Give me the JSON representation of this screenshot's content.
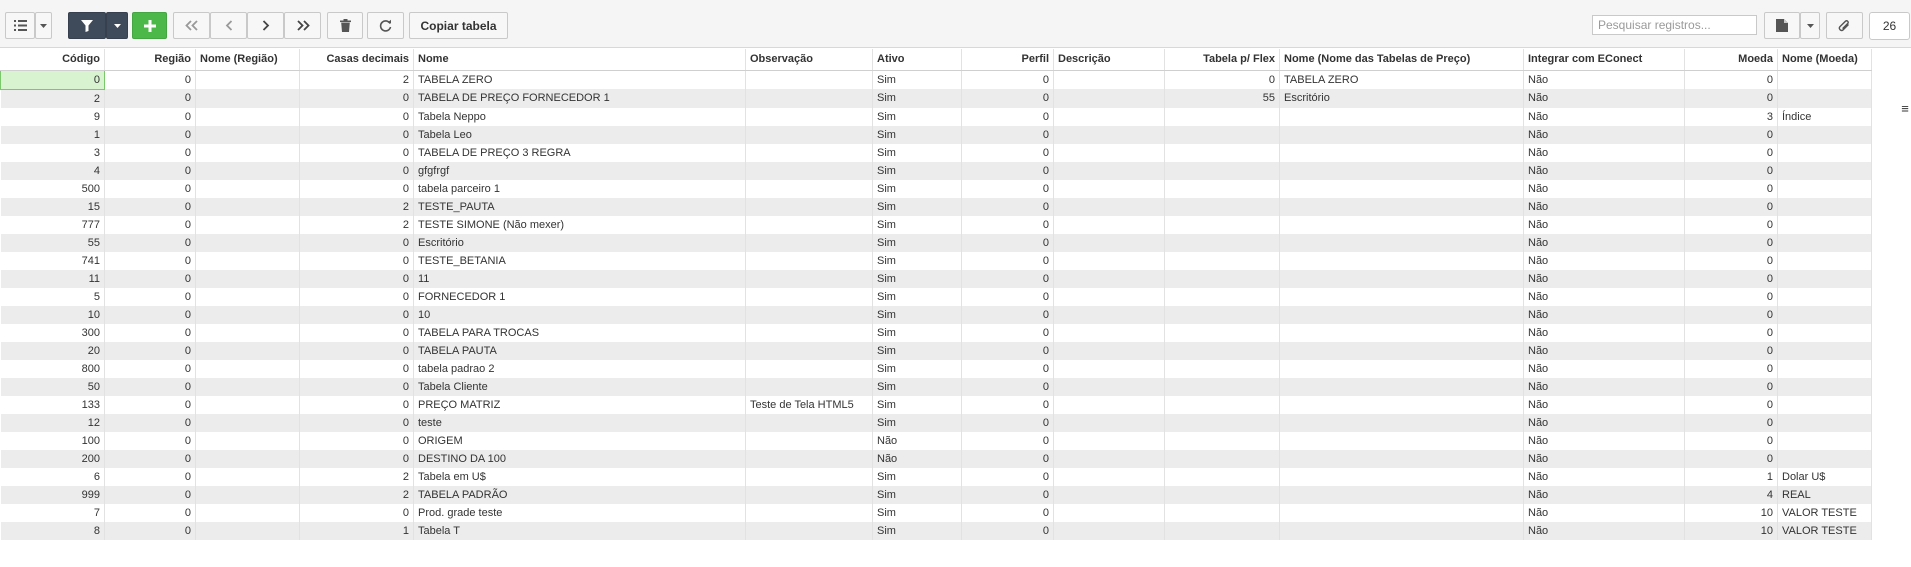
{
  "toolbar": {
    "copy_label": "Copiar tabela",
    "search_placeholder": "Pesquisar registros...",
    "page_size": "26"
  },
  "columns": [
    {
      "key": "codigo",
      "label": "Código",
      "align": "r"
    },
    {
      "key": "regiao",
      "label": "Região",
      "align": "r"
    },
    {
      "key": "nome_regiao",
      "label": "Nome (Região)",
      "align": "l"
    },
    {
      "key": "casas",
      "label": "Casas decimais",
      "align": "r"
    },
    {
      "key": "nome",
      "label": "Nome",
      "align": "l"
    },
    {
      "key": "obs",
      "label": "Observação",
      "align": "l"
    },
    {
      "key": "ativo",
      "label": "Ativo",
      "align": "l"
    },
    {
      "key": "perfil",
      "label": "Perfil",
      "align": "r"
    },
    {
      "key": "descricao",
      "label": "Descrição",
      "align": "l"
    },
    {
      "key": "flex",
      "label": "Tabela p/ Flex",
      "align": "r"
    },
    {
      "key": "nome_tab",
      "label": "Nome (Nome das Tabelas de Preço)",
      "align": "l"
    },
    {
      "key": "econect",
      "label": "Integrar com EConect",
      "align": "l"
    },
    {
      "key": "moeda",
      "label": "Moeda",
      "align": "r"
    },
    {
      "key": "nome_moeda",
      "label": "Nome (Moeda)",
      "align": "l"
    }
  ],
  "rows": [
    [
      "0",
      "0",
      "",
      "2",
      "TABELA ZERO",
      "",
      "Sim",
      "0",
      "",
      "0",
      "TABELA ZERO",
      "Não",
      "0",
      ""
    ],
    [
      "2",
      "0",
      "",
      "0",
      "TABELA DE PREÇO FORNECEDOR 1",
      "",
      "Sim",
      "0",
      "",
      "55",
      "Escritório",
      "Não",
      "0",
      ""
    ],
    [
      "9",
      "0",
      "",
      "0",
      "Tabela Neppo",
      "",
      "Sim",
      "0",
      "",
      "",
      "",
      "Não",
      "3",
      "Índice"
    ],
    [
      "1",
      "0",
      "",
      "0",
      "Tabela Leo",
      "",
      "Sim",
      "0",
      "",
      "",
      "",
      "Não",
      "0",
      ""
    ],
    [
      "3",
      "0",
      "",
      "0",
      "TABELA DE PREÇO 3 REGRA",
      "",
      "Sim",
      "0",
      "",
      "",
      "",
      "Não",
      "0",
      ""
    ],
    [
      "4",
      "0",
      "",
      "0",
      "gfgfrgf",
      "",
      "Sim",
      "0",
      "",
      "",
      "",
      "Não",
      "0",
      ""
    ],
    [
      "500",
      "0",
      "",
      "0",
      "tabela parceiro 1",
      "",
      "Sim",
      "0",
      "",
      "",
      "",
      "Não",
      "0",
      ""
    ],
    [
      "15",
      "0",
      "",
      "2",
      "TESTE_PAUTA",
      "",
      "Sim",
      "0",
      "",
      "",
      "",
      "Não",
      "0",
      ""
    ],
    [
      "777",
      "0",
      "",
      "2",
      "TESTE SIMONE (Não mexer)",
      "",
      "Sim",
      "0",
      "",
      "",
      "",
      "Não",
      "0",
      ""
    ],
    [
      "55",
      "0",
      "",
      "0",
      "Escritório",
      "",
      "Sim",
      "0",
      "",
      "",
      "",
      "Não",
      "0",
      ""
    ],
    [
      "741",
      "0",
      "",
      "0",
      "TESTE_BETANIA",
      "",
      "Sim",
      "0",
      "",
      "",
      "",
      "Não",
      "0",
      ""
    ],
    [
      "11",
      "0",
      "",
      "0",
      "11",
      "",
      "Sim",
      "0",
      "",
      "",
      "",
      "Não",
      "0",
      ""
    ],
    [
      "5",
      "0",
      "",
      "0",
      "FORNECEDOR 1",
      "",
      "Sim",
      "0",
      "",
      "",
      "",
      "Não",
      "0",
      ""
    ],
    [
      "10",
      "0",
      "",
      "0",
      "10",
      "",
      "Sim",
      "0",
      "",
      "",
      "",
      "Não",
      "0",
      ""
    ],
    [
      "300",
      "0",
      "",
      "0",
      "TABELA PARA TROCAS",
      "",
      "Sim",
      "0",
      "",
      "",
      "",
      "Não",
      "0",
      ""
    ],
    [
      "20",
      "0",
      "",
      "0",
      "TABELA PAUTA",
      "",
      "Sim",
      "0",
      "",
      "",
      "",
      "Não",
      "0",
      ""
    ],
    [
      "800",
      "0",
      "",
      "0",
      "tabela padrao 2",
      "",
      "Sim",
      "0",
      "",
      "",
      "",
      "Não",
      "0",
      ""
    ],
    [
      "50",
      "0",
      "",
      "0",
      "Tabela Cliente",
      "",
      "Sim",
      "0",
      "",
      "",
      "",
      "Não",
      "0",
      ""
    ],
    [
      "133",
      "0",
      "",
      "0",
      "PREÇO MATRIZ",
      "Teste de Tela HTML5",
      "Sim",
      "0",
      "",
      "",
      "",
      "Não",
      "0",
      ""
    ],
    [
      "12",
      "0",
      "",
      "0",
      "teste",
      "",
      "Sim",
      "0",
      "",
      "",
      "",
      "Não",
      "0",
      ""
    ],
    [
      "100",
      "0",
      "",
      "0",
      "ORIGEM",
      "",
      "Não",
      "0",
      "",
      "",
      "",
      "Não",
      "0",
      ""
    ],
    [
      "200",
      "0",
      "",
      "0",
      "DESTINO DA 100",
      "",
      "Não",
      "0",
      "",
      "",
      "",
      "Não",
      "0",
      ""
    ],
    [
      "6",
      "0",
      "",
      "2",
      "Tabela em U$",
      "",
      "Sim",
      "0",
      "",
      "",
      "",
      "Não",
      "1",
      "Dolar U$"
    ],
    [
      "999",
      "0",
      "",
      "2",
      "TABELA PADRÃO",
      "",
      "Sim",
      "0",
      "",
      "",
      "",
      "Não",
      "4",
      "REAL"
    ],
    [
      "7",
      "0",
      "",
      "0",
      "Prod. grade teste",
      "",
      "Sim",
      "0",
      "",
      "",
      "",
      "Não",
      "10",
      "VALOR TESTE"
    ],
    [
      "8",
      "0",
      "",
      "1",
      "Tabela T",
      "",
      "Sim",
      "0",
      "",
      "",
      "",
      "Não",
      "10",
      "VALOR TESTE"
    ]
  ],
  "icons": [
    "list-icon",
    "caret-down-icon",
    "filter-icon",
    "plus-icon",
    "first-page-icon",
    "prev-page-icon",
    "next-page-icon",
    "last-page-icon",
    "trash-icon",
    "refresh-icon",
    "export-icon",
    "paperclip-icon",
    "column-menu-icon"
  ],
  "colors": {
    "toolbar_bg": "#f5f5f5",
    "filter_button": "#3f4a5a",
    "add_button": "#4cb849",
    "row_stripe": "#ececec",
    "selected_cell": "#d7f3cf"
  }
}
